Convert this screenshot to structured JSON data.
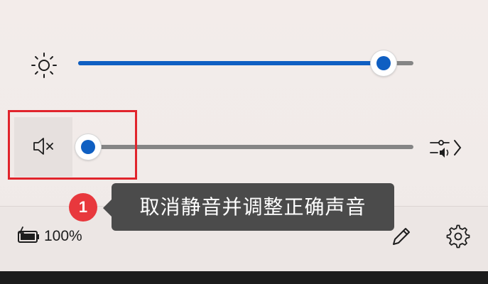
{
  "brightness": {
    "icon": "sun-icon",
    "level_percent": 91
  },
  "volume": {
    "mute_icon": "speaker-muted-icon",
    "level_percent": 3,
    "output_icon": "audio-output-settings-icon"
  },
  "tooltip": {
    "step": "1",
    "text": "取消静音并调整正确声音"
  },
  "footer": {
    "battery_icon": "battery-charging-icon",
    "battery_label": "100%",
    "edit_icon": "pencil-icon",
    "settings_icon": "gear-icon"
  },
  "colors": {
    "accent": "#0f5fc2",
    "highlight": "#e1242c",
    "badge": "#e8383d",
    "tooltip_bg": "#4b4b4b"
  }
}
